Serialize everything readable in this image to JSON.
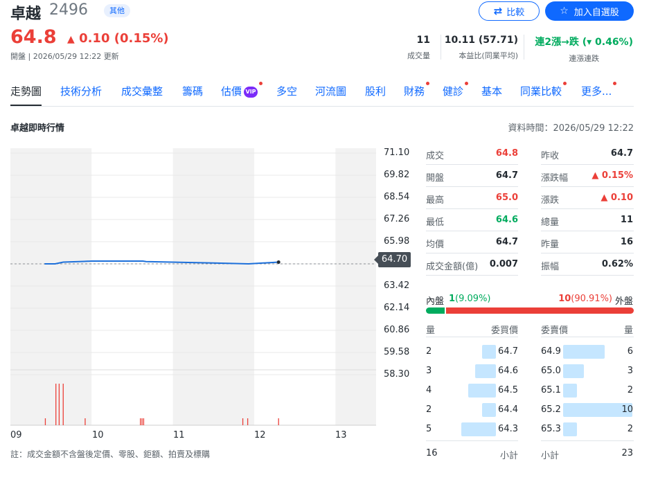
{
  "header": {
    "name": "卓越",
    "code": "2496",
    "badge": "其他",
    "price": "64.8",
    "change": "0.10 (0.15%)",
    "meta": "開盤 | 2026/05/29 12:22 更新",
    "compare_label": "比較",
    "add_watchlist_label": "加入自選股"
  },
  "stats": [
    {
      "value": "11",
      "label": "成交量",
      "color": "#232a31"
    },
    {
      "value": "10.11 (57.71)",
      "label": "本益比(同業平均)",
      "color": "#232a31"
    },
    {
      "value": "連2漲→跌 (▾ 0.46%)",
      "label": "連漲連跌",
      "color": "#00ab5e"
    }
  ],
  "tabs": [
    {
      "label": "走勢圖",
      "active": true,
      "dot": false
    },
    {
      "label": "技術分析",
      "dot": false
    },
    {
      "label": "成交彙整",
      "dot": false
    },
    {
      "label": "籌碼",
      "dot": false
    },
    {
      "label": "估價",
      "dot": true,
      "vip": "VIP"
    },
    {
      "label": "多空",
      "dot": false
    },
    {
      "label": "河流圖",
      "dot": false
    },
    {
      "label": "股利",
      "dot": false
    },
    {
      "label": "財務",
      "dot": true
    },
    {
      "label": "健診",
      "dot": true
    },
    {
      "label": "基本",
      "dot": false
    },
    {
      "label": "同業比較",
      "dot": true
    },
    {
      "label": "更多...",
      "dot": true
    }
  ],
  "section": {
    "title": "卓越即時行情",
    "data_time": "資料時間：2026/05/29 12:22"
  },
  "chart_data": {
    "type": "line",
    "x_ticks": [
      "09",
      "10",
      "11",
      "12",
      "13"
    ],
    "y_ticks": [
      "71.10",
      "69.82",
      "68.54",
      "67.26",
      "65.98",
      "64.70",
      "63.42",
      "62.14",
      "60.86",
      "59.58",
      "58.30"
    ],
    "ref_price": "64.70",
    "ylim": [
      58.3,
      71.1
    ],
    "x_range_hours": [
      9.0,
      13.5
    ],
    "price_series": {
      "x": [
        9.42,
        9.55,
        9.65,
        9.9,
        10.0,
        10.63,
        10.67,
        11.5,
        11.93,
        12.3
      ],
      "y": [
        64.7,
        64.7,
        64.8,
        64.84,
        64.86,
        64.86,
        64.83,
        64.75,
        64.7,
        64.8
      ]
    },
    "volume_series": {
      "x": [
        9.43,
        9.56,
        9.6,
        9.65,
        9.92,
        10.6,
        10.62,
        10.64,
        11.86,
        11.92,
        12.3
      ],
      "y": [
        1,
        6,
        6,
        6,
        1,
        1,
        1,
        1,
        1,
        1,
        1
      ]
    },
    "volume_max": 8
  },
  "quote": {
    "left": [
      {
        "label": "成交",
        "value": "64.8",
        "color": "#eb3f38"
      },
      {
        "label": "開盤",
        "value": "64.7",
        "color": "#232a31"
      },
      {
        "label": "最高",
        "value": "65.0",
        "color": "#eb3f38"
      },
      {
        "label": "最低",
        "value": "64.6",
        "color": "#00ab5e"
      },
      {
        "label": "均價",
        "value": "64.7",
        "color": "#232a31"
      },
      {
        "label": "成交金額(億)",
        "value": "0.007",
        "color": "#232a31"
      }
    ],
    "right": [
      {
        "label": "昨收",
        "value": "64.7",
        "color": "#232a31"
      },
      {
        "label": "漲跌幅",
        "value": "▲ 0.15%",
        "color": "#eb3f38"
      },
      {
        "label": "漲跌",
        "value": "▲ 0.10",
        "color": "#eb3f38"
      },
      {
        "label": "總量",
        "value": "11",
        "color": "#232a31"
      },
      {
        "label": "昨量",
        "value": "16",
        "color": "#232a31"
      },
      {
        "label": "振幅",
        "value": "0.62%",
        "color": "#232a31"
      }
    ]
  },
  "order_balance": {
    "inner_label": "內盤",
    "inner_value": "1",
    "inner_pct": "(9.09%)",
    "outer_label": "外盤",
    "outer_value": "10",
    "outer_pct": "(90.91%)",
    "inner_fraction": 0.0909,
    "inner_color": "#00ab5e",
    "outer_color": "#eb3f38"
  },
  "order_book": {
    "headers": {
      "bid_qty": "量",
      "bid_price": "委買價",
      "ask_price": "委賣價",
      "ask_qty": "量"
    },
    "rows": [
      {
        "bid_qty": "2",
        "bid_price": "64.7",
        "ask_price": "64.9",
        "ask_qty": "6"
      },
      {
        "bid_qty": "3",
        "bid_price": "64.6",
        "ask_price": "65.0",
        "ask_qty": "3"
      },
      {
        "bid_qty": "4",
        "bid_price": "64.5",
        "ask_price": "65.1",
        "ask_qty": "2"
      },
      {
        "bid_qty": "2",
        "bid_price": "64.4",
        "ask_price": "65.2",
        "ask_qty": "10"
      },
      {
        "bid_qty": "5",
        "bid_price": "64.3",
        "ask_price": "65.3",
        "ask_qty": "2"
      }
    ],
    "max_qty": 10,
    "footer": {
      "bid_total": "16",
      "bid_label": "小計",
      "ask_label": "小計",
      "ask_total": "23"
    }
  },
  "note": "註：成交金額不含盤後定價、零股、鉅額、拍賣及標購"
}
